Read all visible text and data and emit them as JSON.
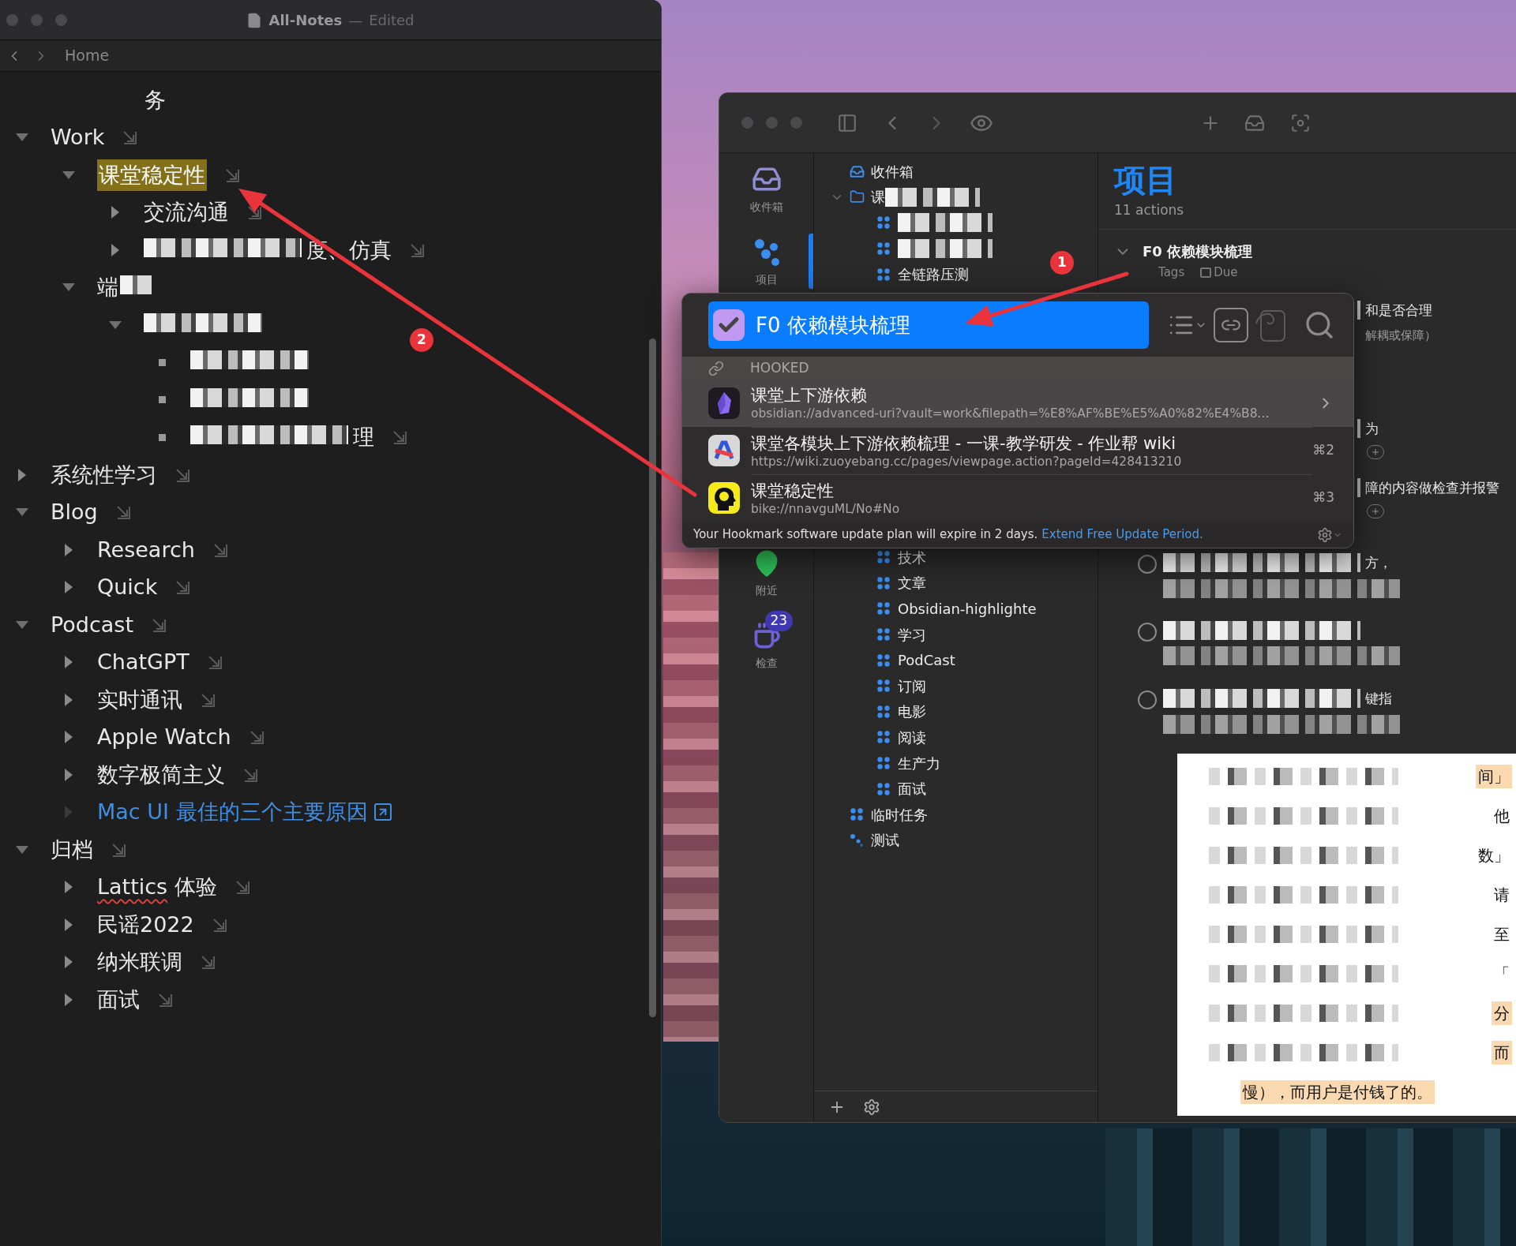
{
  "notes_window": {
    "title": "All-Notes",
    "separator": "—",
    "status": "Edited",
    "breadcrumb": "Home",
    "wrapped_line": "务",
    "outline": [
      {
        "kind": "branch",
        "expanded": true,
        "text": "Work",
        "highlighted": false,
        "children": [
          {
            "kind": "branch",
            "expanded": true,
            "text": "课堂稳定性",
            "highlighted": true,
            "children": [
              {
                "kind": "branch",
                "expanded": false,
                "text": "交流沟通",
                "highlighted": false
              },
              {
                "kind": "masked_branch",
                "expanded": false,
                "text": "度、仿真",
                "highlighted": false
              }
            ]
          },
          {
            "kind": "tail_masked_branch",
            "expanded": true,
            "text": "端",
            "highlighted": false,
            "children": [
              {
                "kind": "masked_branch",
                "expanded": true,
                "highlighted": false,
                "children": [
                  {
                    "kind": "masked_bullet",
                    "highlighted": false
                  },
                  {
                    "kind": "masked_bullet",
                    "highlighted": false
                  },
                  {
                    "kind": "masked_bullet",
                    "text": "理",
                    "highlighted": false
                  }
                ]
              }
            ]
          }
        ]
      },
      {
        "kind": "branch",
        "expanded": false,
        "text": "系统性学习",
        "highlighted": false
      },
      {
        "kind": "branch",
        "expanded": true,
        "text": "Blog",
        "highlighted": false,
        "children": [
          {
            "kind": "branch",
            "expanded": false,
            "text": "Research",
            "highlighted": false
          },
          {
            "kind": "branch",
            "expanded": false,
            "text": "Quick",
            "highlighted": false
          }
        ]
      },
      {
        "kind": "branch",
        "expanded": true,
        "text": "Podcast",
        "highlighted": false,
        "children": [
          {
            "kind": "branch",
            "expanded": false,
            "text": "ChatGPT",
            "highlighted": false
          },
          {
            "kind": "branch",
            "expanded": false,
            "text": "实时通讯",
            "highlighted": false
          },
          {
            "kind": "branch",
            "expanded": false,
            "text": "Apple Watch",
            "highlighted": false
          },
          {
            "kind": "branch",
            "expanded": false,
            "text": "数字极简主义",
            "highlighted": false
          },
          {
            "kind": "link",
            "expanded": false,
            "text": "Mac UI 最佳的三个主要原因",
            "highlighted": false
          }
        ]
      },
      {
        "kind": "branch",
        "expanded": true,
        "text": "归档",
        "highlighted": false,
        "children": [
          {
            "kind": "branch",
            "expanded": false,
            "text": "Lattics 体验",
            "highlighted": false,
            "spell_underline": true
          },
          {
            "kind": "branch",
            "expanded": false,
            "text": "民谣2022",
            "highlighted": false
          },
          {
            "kind": "branch",
            "expanded": false,
            "text": "纳米联调",
            "highlighted": false
          },
          {
            "kind": "branch",
            "expanded": false,
            "text": "面试",
            "highlighted": false
          }
        ]
      }
    ]
  },
  "tasks_window": {
    "perspectives": [
      {
        "kind": "inbox",
        "label": "收件箱",
        "selected": false
      },
      {
        "kind": "projects",
        "label": "项目",
        "selected": true
      },
      {
        "kind": "nearby",
        "label": "附近",
        "selected": false
      },
      {
        "kind": "review",
        "label": "检查",
        "badge": "23",
        "selected": false
      }
    ],
    "projects": [
      {
        "kind": "inbox",
        "label": "收件箱"
      },
      {
        "kind": "folder",
        "label": "课",
        "redacted": true,
        "expanded": true,
        "children": [
          {
            "kind": "project",
            "redacted": true
          },
          {
            "kind": "project",
            "redacted": true
          },
          {
            "kind": "project",
            "label": "全链路压测"
          },
          {
            "kind": "project",
            "label": "技术"
          },
          {
            "kind": "project",
            "label": "文章"
          },
          {
            "kind": "project",
            "label": "Obsidian-highlighte"
          },
          {
            "kind": "project",
            "label": "学习"
          },
          {
            "kind": "project",
            "label": "PodCast"
          },
          {
            "kind": "project",
            "label": "订阅"
          },
          {
            "kind": "project",
            "label": "电影"
          },
          {
            "kind": "project",
            "label": "阅读"
          },
          {
            "kind": "project",
            "label": "生产力"
          },
          {
            "kind": "project",
            "label": "面试"
          }
        ]
      },
      {
        "kind": "project",
        "label": "临时任务"
      },
      {
        "kind": "single_actions",
        "label": "测试"
      }
    ],
    "header": {
      "title": "项目",
      "subtitle": "11 actions"
    },
    "project": {
      "title": "F0 依赖模块梳理",
      "expanded": true,
      "tags_label": "Tags",
      "due_label": "Due"
    },
    "tasks": [
      {
        "text": "和是否合理",
        "note": "解耦或保障）",
        "has_add": false
      },
      {
        "text": "为",
        "has_add": true
      },
      {
        "text": "障的内容做检查并报警",
        "has_add": true
      },
      {
        "text": "方，",
        "has_add": false,
        "checked": false
      },
      {
        "has_add": false,
        "checked": false
      },
      {
        "text": "键指",
        "has_add": false,
        "checked": false
      }
    ],
    "note_lines": [
      {
        "text": "间」",
        "highlighted": true
      },
      {
        "text": "他",
        "highlighted": false
      },
      {
        "text": "数」",
        "highlighted": false
      },
      {
        "text": "请",
        "highlighted": false
      },
      {
        "text": "至",
        "highlighted": false
      },
      {
        "text": "「",
        "highlighted": false
      },
      {
        "text": "分",
        "highlighted": true
      },
      {
        "text": "而",
        "highlighted": true
      },
      {
        "text": "慢），而用户是付钱了的。",
        "highlighted": true
      }
    ]
  },
  "hookmark": {
    "title": "F0 依赖模块梳理",
    "section": "HOOKED",
    "items": [
      {
        "kind": "obsidian",
        "title": "课堂上下游依赖",
        "url": "obsidian://advanced-uri?vault=work&filepath=%E8%AF%BE%E5%A0%82%E4%B8...",
        "selected": true
      },
      {
        "kind": "wiki",
        "title": "课堂各模块上下游依赖梳理 - 一课-教学研发 - 作业帮 wiki",
        "url": "https://wiki.zuoyebang.cc/pages/viewpage.action?pageId=428413210",
        "shortcut": "⌘2",
        "selected": false
      },
      {
        "kind": "bike",
        "title": "课堂稳定性",
        "url": "bike://nnavguML/No#No",
        "shortcut": "⌘3",
        "selected": false
      }
    ],
    "footer": "Your Hookmark software update plan will expire in 2 days.",
    "footer_link": "Extend Free Update Period."
  },
  "annotations": [
    {
      "label": "1"
    },
    {
      "label": "2"
    }
  ]
}
